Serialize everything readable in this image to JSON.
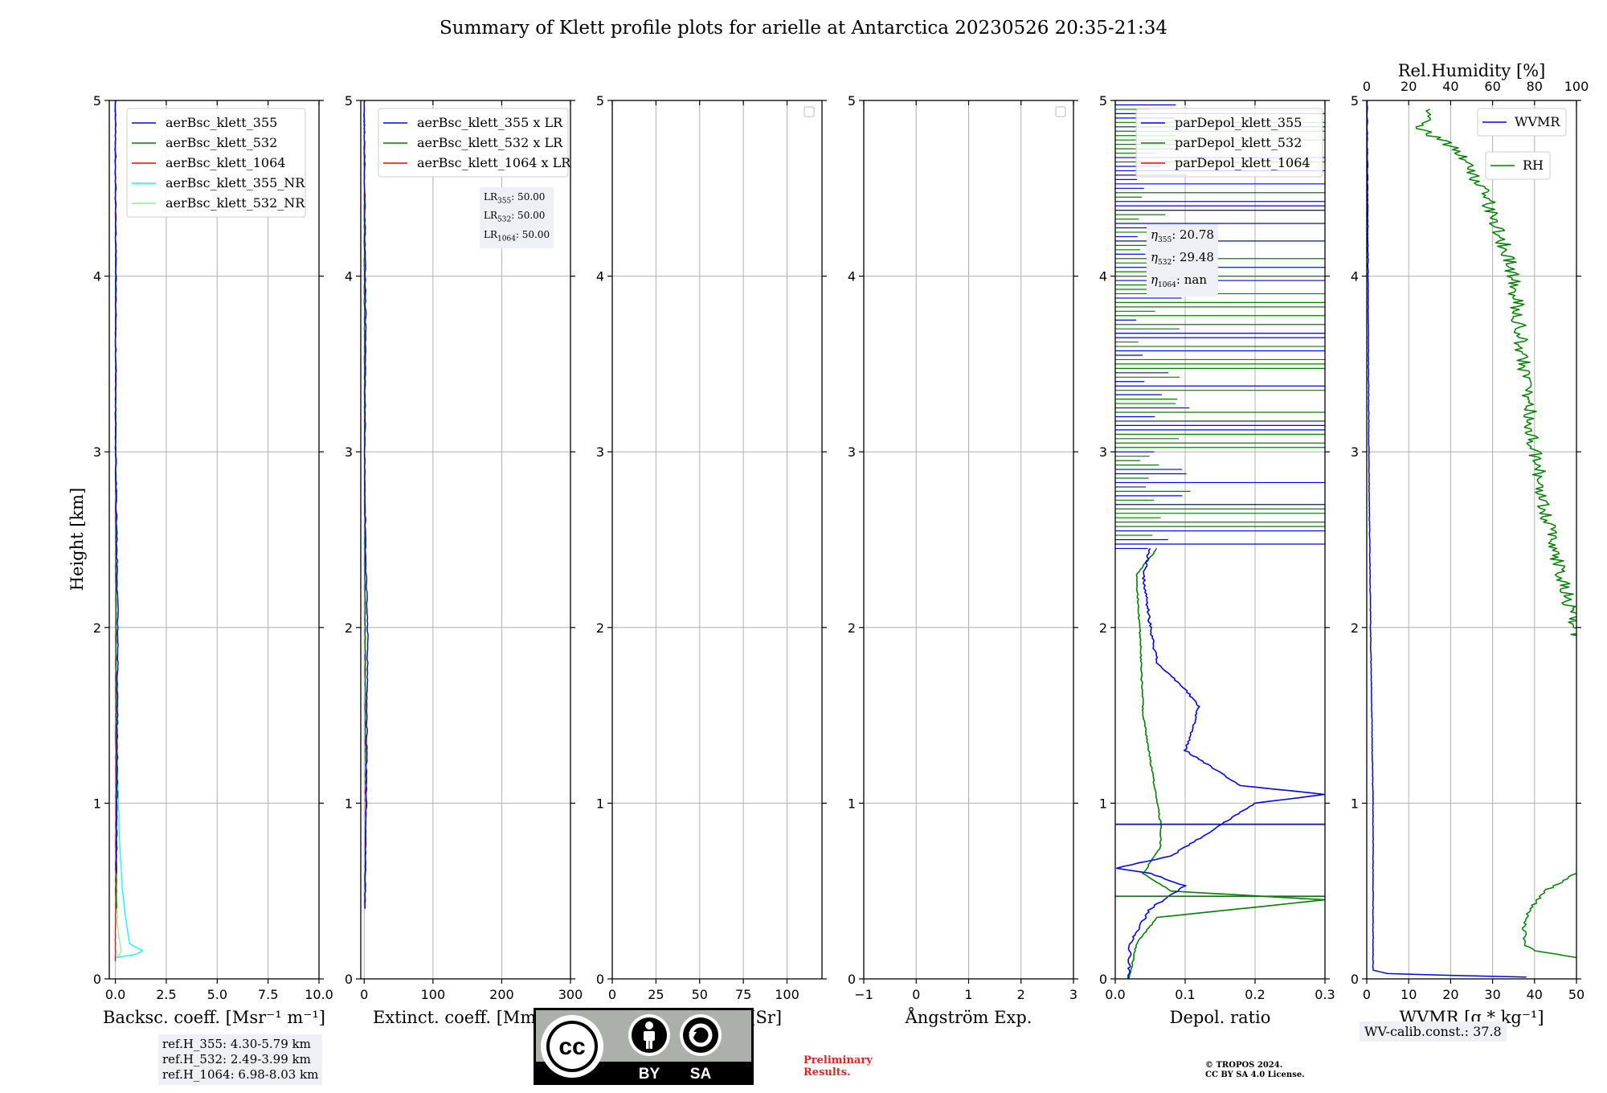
{
  "title": "Summary of Klett profile plots for arielle at Antarctica 20230526 20:35-21:34",
  "ylabel": "Height [km]",
  "colors": {
    "b355": "#0000ff",
    "g532": "#008000",
    "r1064": "#ff0000",
    "nr355": "#00ffff",
    "nr532": "#90ee90",
    "grid": "#b0b0b0"
  },
  "panels": [
    {
      "xlabel": "Backsc. coeff. [Msr⁻¹ m⁻¹]",
      "xlim": [
        -0.3,
        10
      ],
      "xticks": [
        "0.0",
        "2.5",
        "5.0",
        "7.5",
        "10.0"
      ],
      "xtickvals": [
        0,
        2.5,
        5,
        7.5,
        10
      ],
      "legend": [
        "aerBsc_klett_355",
        "aerBsc_klett_532",
        "aerBsc_klett_1064",
        "aerBsc_klett_355_NR",
        "aerBsc_klett_532_NR"
      ]
    },
    {
      "xlabel": "Extinct. coeff. [Mm⁻¹]",
      "xlim": [
        -5,
        300
      ],
      "xticks": [
        "0",
        "100",
        "200",
        "300"
      ],
      "xtickvals": [
        0,
        100,
        200,
        300
      ],
      "legend": [
        "aerBsc_klett_355 x LR",
        "aerBsc_klett_532 x LR",
        "aerBsc_klett_1064 x LR"
      ]
    },
    {
      "xlabel": "Lidar ratio [Sr]",
      "xlim": [
        0,
        120
      ],
      "xticks": [
        "0",
        "25",
        "50",
        "75",
        "100"
      ],
      "xtickvals": [
        0,
        25,
        50,
        75,
        100
      ],
      "legend": []
    },
    {
      "xlabel": "Ångström Exp.",
      "xlim": [
        -1,
        3
      ],
      "xticks": [
        "−1",
        "0",
        "1",
        "2",
        "3"
      ],
      "xtickvals": [
        -1,
        0,
        1,
        2,
        3
      ],
      "legend": []
    },
    {
      "xlabel": "Depol. ratio",
      "xlim": [
        0,
        0.3
      ],
      "xticks": [
        "0.0",
        "0.1",
        "0.2",
        "0.3"
      ],
      "xtickvals": [
        0,
        0.1,
        0.2,
        0.3
      ],
      "legend": [
        "parDepol_klett_355",
        "parDepol_klett_532",
        "parDepol_klett_1064"
      ]
    },
    {
      "xlabel": "WVMR [g * kg⁻¹]",
      "xlim": [
        0,
        50
      ],
      "xticks": [
        "0",
        "10",
        "20",
        "30",
        "40",
        "50"
      ],
      "xtickvals": [
        0,
        10,
        20,
        30,
        40,
        50
      ],
      "toplabel": "Rel.Humidity [%]",
      "topticks": [
        "0",
        "20",
        "40",
        "60",
        "80",
        "100"
      ],
      "toptickvals": [
        0,
        20,
        40,
        60,
        80,
        100
      ],
      "legend": [
        "WVMR",
        "RH"
      ]
    }
  ],
  "yticks": [
    "0",
    "1",
    "2",
    "3",
    "4",
    "5"
  ],
  "lr_box": {
    "lines": [
      [
        "LR",
        "355",
        ": 50.00"
      ],
      [
        "LR",
        "532",
        ": 50.00"
      ],
      [
        "LR",
        "1064",
        ": 50.00"
      ]
    ]
  },
  "eta_box": {
    "lines": [
      [
        "η",
        "355",
        ": 20.78"
      ],
      [
        "η",
        "532",
        ": 29.48"
      ],
      [
        "η",
        "1064",
        ": nan"
      ]
    ]
  },
  "refh": {
    "lines": [
      "ref.H_355: 4.30-5.79 km",
      "ref.H_532: 2.49-3.99 km",
      "ref.H_1064: 6.98-8.03 km"
    ]
  },
  "wvcal": "WV-calib.const.: 37.8",
  "prelim": [
    "Preliminary",
    "Results."
  ],
  "copyright": [
    "© TROPOS 2024.",
    "CC BY SA 4.0 License."
  ],
  "cc": {
    "by": "BY",
    "sa": "SA",
    "cc": "cc"
  },
  "chart_data": {
    "type": "line",
    "title": "Summary of Klett profile plots for arielle at Antarctica 20230526 20:35-21:34",
    "ylabel": "Height [km]",
    "ylim": [
      0,
      5
    ],
    "panels": [
      {
        "xlabel": "Backsc. coeff. [Msr⁻¹ m⁻¹]",
        "series": [
          {
            "name": "aerBsc_klett_355_NR",
            "height": [
              0.12,
              0.15,
              0.2,
              0.35,
              0.5,
              0.8,
              1.2,
              1.5
            ],
            "values": [
              0.0,
              1.5,
              0.7,
              0.5,
              0.35,
              0.2,
              0.1,
              0.05
            ]
          },
          {
            "name": "aerBsc_klett_532_NR",
            "height": [
              0.12,
              0.15,
              0.3,
              0.6,
              1.0
            ],
            "values": [
              0.0,
              0.3,
              0.1,
              0.05,
              0.02
            ]
          },
          {
            "name": "aerBsc_klett_355",
            "height": [
              0.6,
              1.0,
              1.5,
              2.0,
              2.4,
              3.0,
              4.0,
              5.0
            ],
            "values": [
              0.05,
              0.08,
              0.1,
              0.12,
              0.08,
              0.02,
              0.02,
              0.0
            ]
          }
        ]
      },
      {
        "xlabel": "Extinct. coeff. [Mm⁻¹]",
        "series": [
          {
            "name": "aerBsc_klett_355 x LR",
            "height": [
              0.4,
              1.0,
              1.5,
              2.0,
              2.4,
              3.0,
              3.8,
              5.0
            ],
            "values": [
              1,
              3,
              4,
              5,
              2,
              1,
              2,
              0
            ]
          }
        ]
      },
      {
        "xlabel": "Depol. ratio",
        "series": [
          {
            "name": "parDepol_klett_355",
            "height": [
              0.0,
              0.2,
              0.4,
              0.53,
              0.63,
              1.05,
              1.1,
              1.3,
              1.55,
              1.65,
              1.8,
              2.0,
              2.3,
              2.5
            ],
            "values": [
              0.02,
              0.021,
              0.05,
              0.1,
              0.001,
              0.3,
              0.18,
              0.1,
              0.12,
              0.1,
              0.05,
              0.05,
              0.04,
              0.05
            ]
          },
          {
            "name": "parDepol_klett_532",
            "height": [
              0.0,
              0.2,
              0.35,
              0.45,
              0.6,
              0.75,
              0.88,
              1.5,
              2.0,
              2.3,
              2.8,
              3.0
            ],
            "values": [
              0.02,
              0.03,
              0.06,
              0.3,
              0.04,
              0.065,
              0.065,
              0.04,
              0.035,
              0.03,
              0.03,
              0.05
            ]
          }
        ]
      },
      {
        "xlabel": "WVMR [g * kg⁻¹]",
        "series": [
          {
            "name": "WVMR",
            "height": [
              0.01,
              0.02,
              0.05,
              0.5,
              1.0,
              2.0,
              3.0,
              4.0,
              5.0
            ],
            "values": [
              38,
              5,
              1.5,
              1.5,
              1.5,
              0.9,
              0.5,
              0.3,
              0.1
            ]
          },
          {
            "name": "RH",
            "axis": "top",
            "height": [
              0.12,
              0.2,
              0.4,
              0.6,
              1.9,
              2.5,
              3.0,
              3.5,
              4.0,
              4.3,
              4.7,
              4.9
            ],
            "values": [
              100,
              80,
              75,
              100,
              100,
              88,
              80,
              75,
              70,
              62,
              40,
              20
            ]
          }
        ]
      }
    ]
  }
}
